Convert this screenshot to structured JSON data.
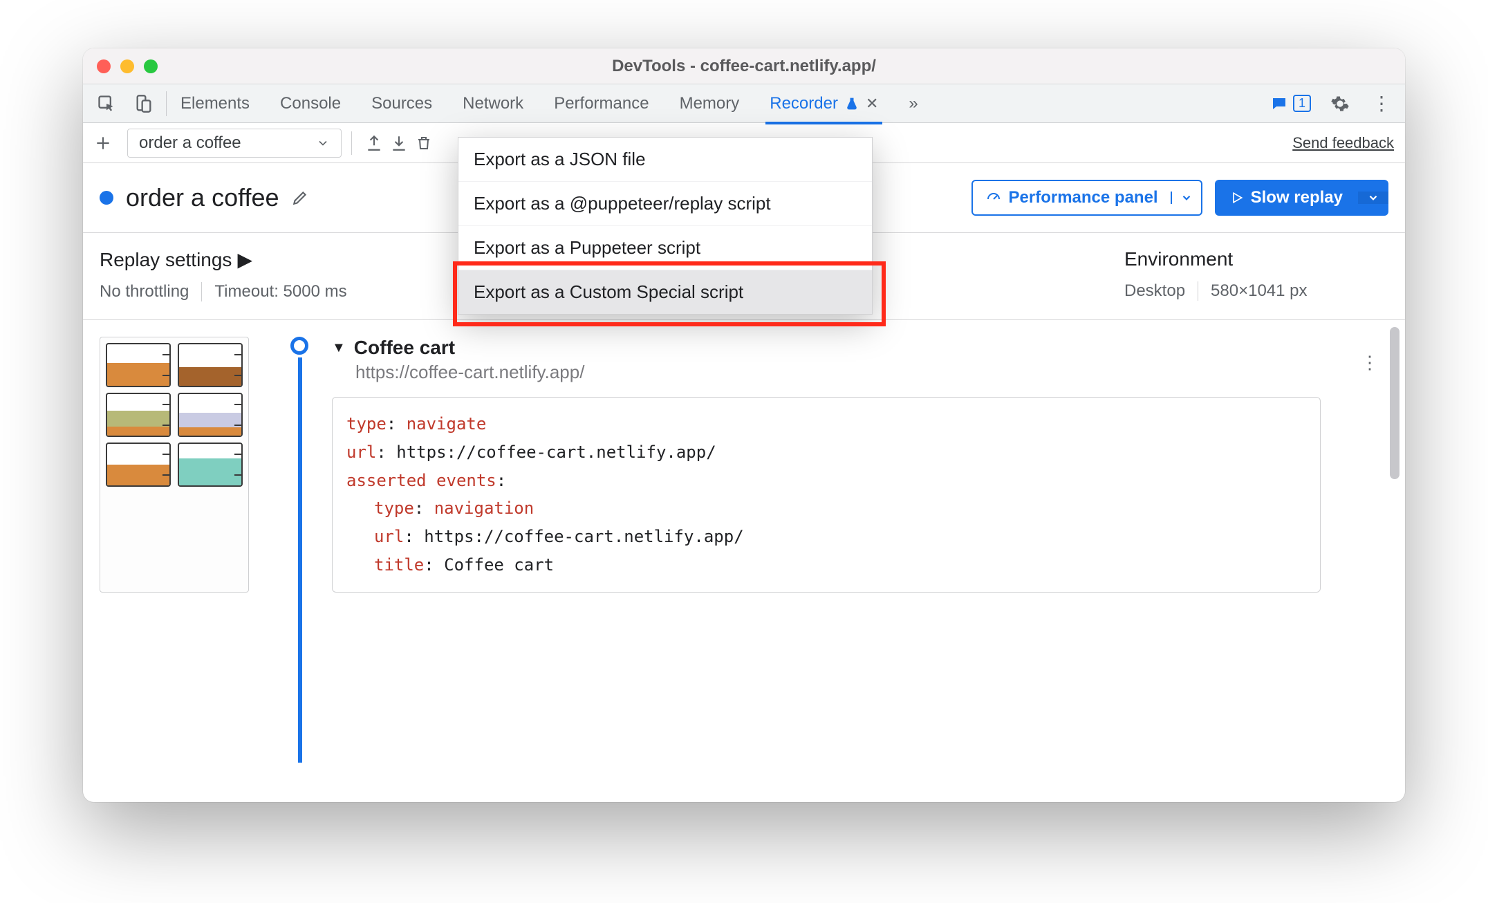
{
  "window": {
    "title": "DevTools - coffee-cart.netlify.app/"
  },
  "tabstrip": {
    "tabs": [
      "Elements",
      "Console",
      "Sources",
      "Network",
      "Performance",
      "Memory"
    ],
    "active": "Recorder",
    "msg_count": "1"
  },
  "toolbar": {
    "recording_name": "order a coffee",
    "feedback": "Send feedback"
  },
  "header": {
    "title": "order a coffee",
    "perf_btn": "Performance panel",
    "replay_btn": "Slow replay"
  },
  "export_menu": {
    "items": [
      "Export as a JSON file",
      "Export as a @puppeteer/replay script",
      "Export as a Puppeteer script",
      "Export as a Custom Special script"
    ]
  },
  "replay_settings": {
    "heading": "Replay settings",
    "throttling": "No throttling",
    "timeout": "Timeout: 5000 ms"
  },
  "environment": {
    "heading": "Environment",
    "device": "Desktop",
    "viewport": "580×1041 px"
  },
  "step": {
    "title": "Coffee cart",
    "url": "https://coffee-cart.netlify.app/",
    "code": {
      "l1k": "type",
      "l1v": "navigate",
      "l2k": "url",
      "l2v": "https://coffee-cart.netlify.app/",
      "l3k": "asserted events",
      "l4k": "type",
      "l4v": "navigation",
      "l5k": "url",
      "l5v": "https://coffee-cart.netlify.app/",
      "l6k": "title",
      "l6v": "Coffee cart"
    }
  }
}
